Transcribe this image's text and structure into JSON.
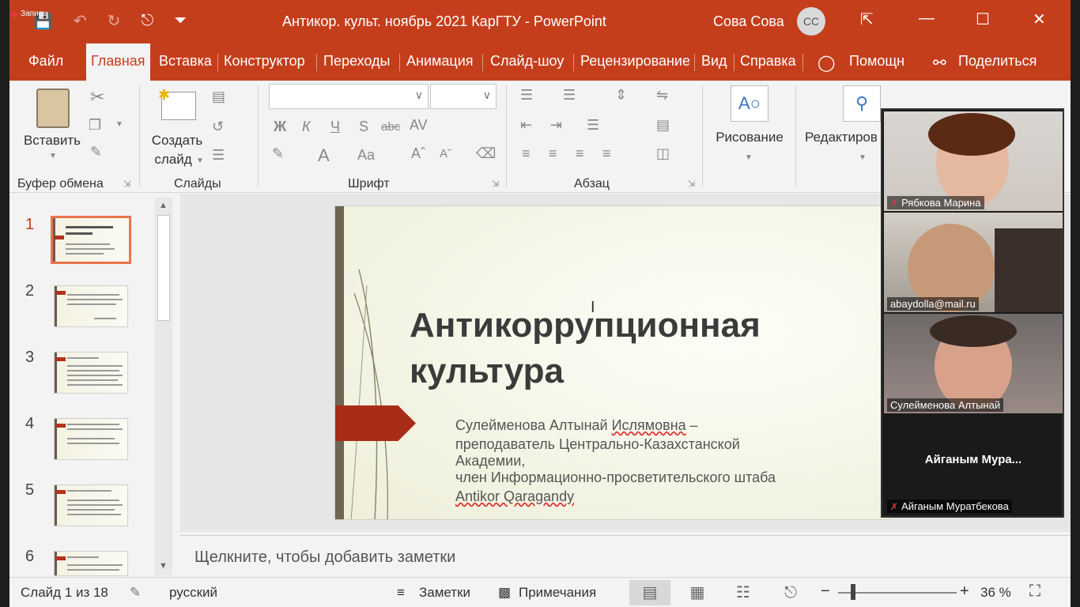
{
  "recording": {
    "label": "Запись"
  },
  "titlebar": {
    "doc_title": "Антикор. культ. ноябрь 2021 КарГТУ  -  PowerPoint",
    "user_name": "Сова Сова",
    "avatar_initials": "СС",
    "accent": "#c43e1c"
  },
  "tabs": [
    {
      "label": "Файл"
    },
    {
      "label": "Главная"
    },
    {
      "label": "Вставка"
    },
    {
      "label": "Конструктор"
    },
    {
      "label": "Переходы"
    },
    {
      "label": "Анимация"
    },
    {
      "label": "Слайд-шоу"
    },
    {
      "label": "Рецензирование"
    },
    {
      "label": "Вид"
    },
    {
      "label": "Справка"
    },
    {
      "label": "Помощн"
    },
    {
      "label": "Поделиться"
    }
  ],
  "ribbon": {
    "paste_label": "Вставить",
    "new_slide_label_1": "Создать",
    "new_slide_label_2": "слайд",
    "drawing_label": "Рисование",
    "editing_label": "Редактиров",
    "groups": {
      "clipboard": "Буфер обмена",
      "slides": "Слайды",
      "font": "Шрифт",
      "paragraph": "Абзац"
    },
    "font_buttons": {
      "bold": "Ж",
      "italic": "К",
      "underline": "Ч",
      "shadow": "S",
      "strike": "abc",
      "spacing": "AV",
      "color": "A",
      "case": "Aa"
    }
  },
  "thumbnails": [
    {
      "num": "1"
    },
    {
      "num": "2"
    },
    {
      "num": "3"
    },
    {
      "num": "4"
    },
    {
      "num": "5"
    },
    {
      "num": "6"
    }
  ],
  "slide": {
    "title_line1": "Антикоррупционная",
    "title_line2": "культура",
    "body_line1_a": "Сулейменова Алтынай ",
    "body_line1_b": "Ислямовна",
    "body_line1_c": " –",
    "body_line2": "преподаватель Центрально-Казахстанской",
    "body_line3": "Академии,",
    "body_line4": "член Информационно-просветительского штаба",
    "body_line5": "Antikor Qaragandy"
  },
  "notes": {
    "placeholder": "Щелкните, чтобы добавить заметки"
  },
  "status": {
    "slide_count": "Слайд 1 из 18",
    "language": "русский",
    "notes_label": "Заметки",
    "comments_label": "Примечания",
    "zoom": "36 %"
  },
  "video": {
    "participants": [
      {
        "name": "Рябкова Марина",
        "muted": true
      },
      {
        "name": "abaydolla@mail.ru",
        "muted": false
      },
      {
        "name": "Сулейменова Алтынай",
        "muted": false
      },
      {
        "name": "Айганым Муратбекова",
        "display": "Айганым  Мура...",
        "muted": true
      }
    ]
  }
}
